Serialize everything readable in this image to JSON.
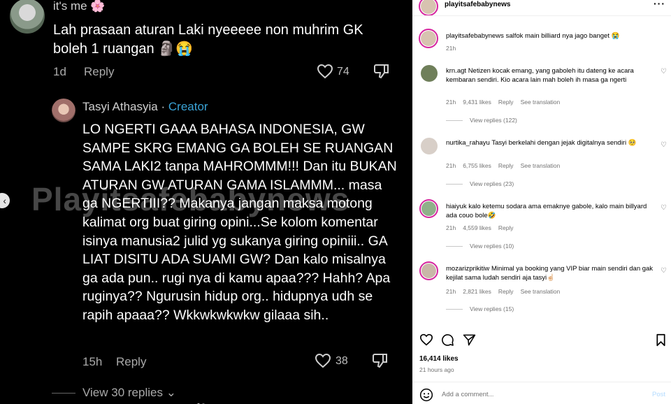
{
  "tiktok": {
    "comment1": {
      "username": "it's me 🌸",
      "text": "Lah prasaan aturan Laki nyeeeee non muhrim GK boleh 1 ruangan 🗿😭",
      "age": "1d",
      "reply": "Reply",
      "likes": "74"
    },
    "comment2": {
      "username": "Tasyi Athasyia",
      "separator": "·",
      "creator": "Creator",
      "text": "LO NGERTI GAAA BAHASA INDONESIA, GW SAMPE SKRG EMANG GA BOLEH SE RUANGAN SAMA LAKI2 tanpa MAHROMMM!!! Dan itu BUKAN ATURAN GW ATURAN GAMA ISLAMMM... masa ga NGERTIII?? Makanya jangan maksa motong kalimat org buat giring opini...Se kolom komentar isinya manusia2 julid yg sukanya giring opiniii.. GA LIAT DISITU ADA SUAMI GW? Dan kalo misalnya ga ada pun.. rugi nya di kamu apaa??? Hahh? Apa ruginya?? Ngurusin hidup org.. hidupnya udh se rapih apaaa?? Wkkwkwkwkw gilaaa sih..",
      "age": "15h",
      "reply": "Reply",
      "likes": "38"
    },
    "view_replies": "View 30 replies",
    "watermark": "Playitsafebabynews"
  },
  "instagram": {
    "header_user": "playitsafebabynews",
    "caption": {
      "user": "playitsafebabynews",
      "text": "salfok main billiard nya jago banget 😭",
      "age": "21h"
    },
    "comments": [
      {
        "user": "krn.agt",
        "text": "Netizen kocak emang, yang gaboleh itu dateng ke acara kembaran sendiri. Kio acara lain mah boleh ih masa ga ngerti",
        "age": "21h",
        "likes": "9,431 likes",
        "reply": "Reply",
        "translate": "See translation",
        "view_replies": "View replies (122)"
      },
      {
        "user": "nurtika_rahayu",
        "text": "Tasyi berkelahi dengan jejak digitalnya sendiri 🥺",
        "age": "21h",
        "likes": "6,755 likes",
        "reply": "Reply",
        "translate": "See translation",
        "view_replies": "View replies (23)"
      },
      {
        "user": "hiaiyuk",
        "text": "kalo ketemu sodara ama emaknye gabole, kalo main billyard ada couo bole🤣",
        "age": "21h",
        "likes": "4,559 likes",
        "reply": "Reply",
        "translate": "",
        "view_replies": "View replies (10)"
      },
      {
        "user": "mozarizprikitiw",
        "text": "Minimal ya booking yang VIP biar main sendiri dan gak kejilat sama ludah sendiri aja tasyi☝🏻",
        "age": "21h",
        "likes": "2,821 likes",
        "reply": "Reply",
        "translate": "See translation",
        "view_replies": "View replies (15)"
      }
    ],
    "likes_total": "16,414 likes",
    "time_ago": "21 hours ago",
    "add_comment_placeholder": "Add a comment...",
    "post_label": "Post",
    "more": "···"
  }
}
